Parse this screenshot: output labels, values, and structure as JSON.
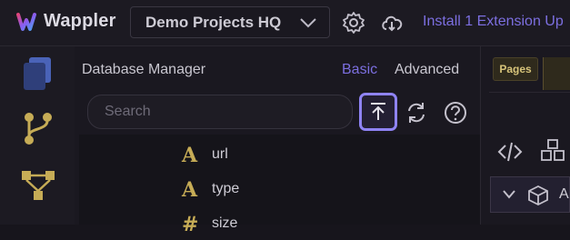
{
  "app": {
    "name": "Wappler"
  },
  "project": {
    "selected": "Demo Projects HQ"
  },
  "toolbar": {
    "install_label": "Install 1 Extension Up"
  },
  "panel": {
    "title": "Database Manager",
    "modes": {
      "basic": "Basic",
      "advanced": "Advanced"
    },
    "search_placeholder": "Search"
  },
  "fields": [
    {
      "icon": "A",
      "name": "url"
    },
    {
      "icon": "A",
      "name": "type"
    },
    {
      "icon": "#",
      "name": "size"
    }
  ],
  "right_panel": {
    "tab_pages": "Pages",
    "row_label": "A"
  },
  "colors": {
    "accent": "#7c6fe0",
    "highlight_border": "#8f83f5",
    "type_icon": "#c6ac56"
  }
}
